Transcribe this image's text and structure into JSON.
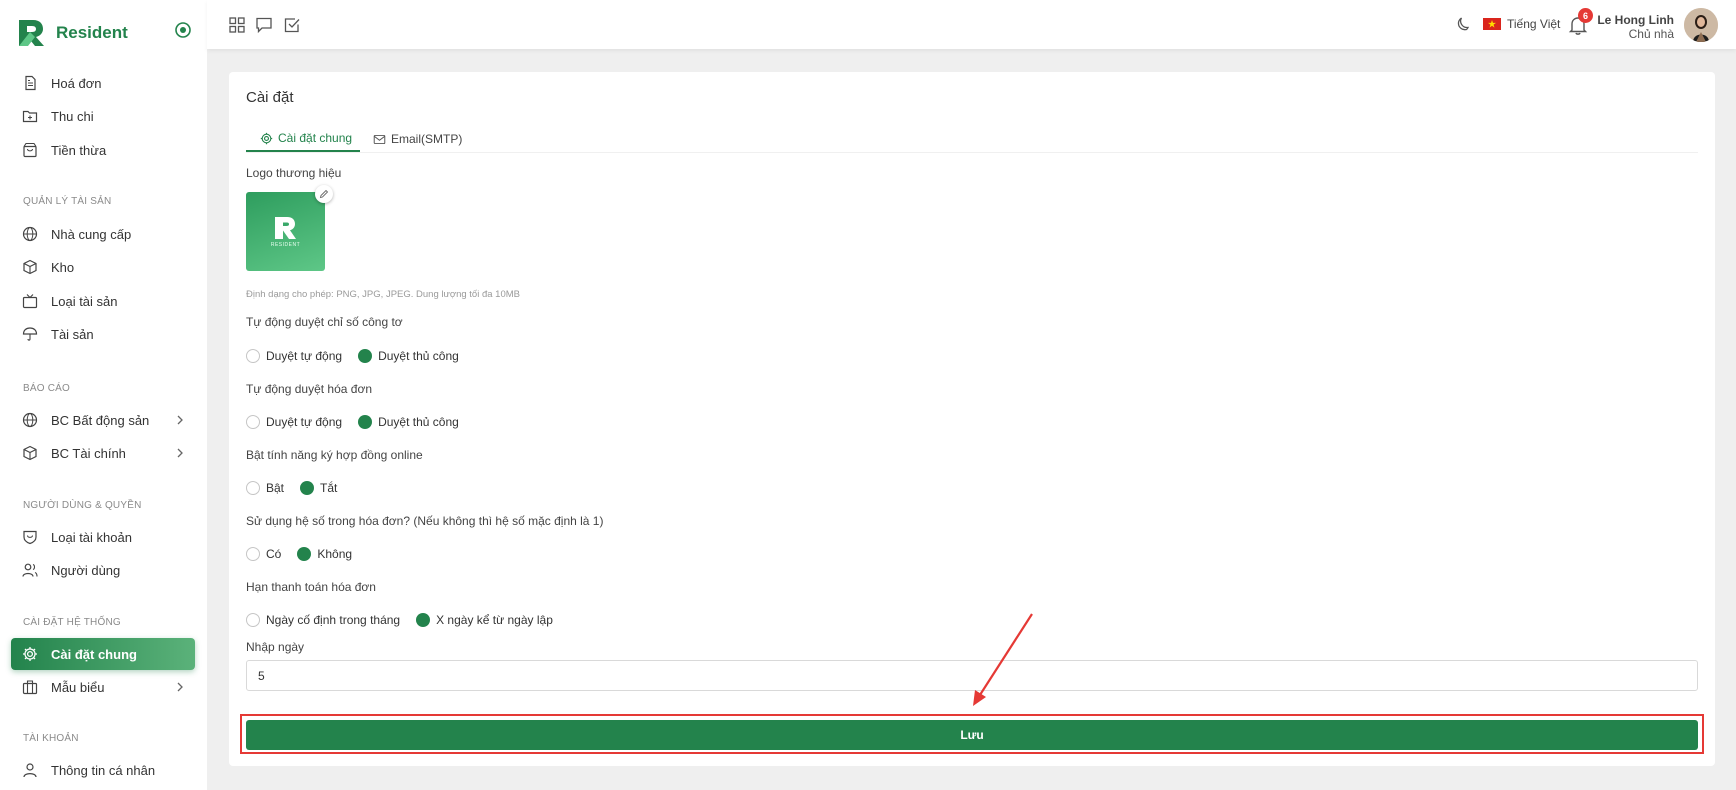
{
  "brand": {
    "name": "Resident"
  },
  "sidebar": {
    "items_top": [
      {
        "label": "Hoá đơn",
        "icon": "file-icon"
      },
      {
        "label": "Thu chi",
        "icon": "folder-plus-icon"
      },
      {
        "label": "Tiền thừa",
        "icon": "bag-icon"
      }
    ],
    "section_assets": "QUẢN LÝ TÀI SẢN",
    "items_assets": [
      {
        "label": "Nhà cung cấp",
        "icon": "globe-icon"
      },
      {
        "label": "Kho",
        "icon": "box-icon"
      },
      {
        "label": "Loại tài sản",
        "icon": "tv-icon"
      },
      {
        "label": "Tài sản",
        "icon": "umbrella-icon"
      }
    ],
    "section_reports": "BÁO CÁO",
    "items_reports": [
      {
        "label": "BC Bất động sản",
        "icon": "globe-icon"
      },
      {
        "label": "BC Tài chính",
        "icon": "box-icon"
      }
    ],
    "section_users": "NGƯỜI DÙNG & QUYỀN",
    "items_users": [
      {
        "label": "Loại tài khoản",
        "icon": "shield-icon"
      },
      {
        "label": "Người dùng",
        "icon": "users-icon"
      }
    ],
    "section_system": "CÀI ĐẶT HỆ THỐNG",
    "items_system": [
      {
        "label": "Cài đặt chung",
        "icon": "gear-icon",
        "active": true
      },
      {
        "label": "Mẫu biểu",
        "icon": "briefcase-icon"
      }
    ],
    "section_account": "TÀI KHOẢN",
    "items_account": [
      {
        "label": "Thông tin cá nhân",
        "icon": "user-icon"
      }
    ]
  },
  "topbar": {
    "language": "Tiếng Việt",
    "notification_count": "6",
    "user_name": "Le Hong Linh",
    "user_role": "Chủ nhà"
  },
  "page": {
    "title": "Cài đặt",
    "tabs": [
      {
        "label": "Cài đặt chung",
        "active": true
      },
      {
        "label": "Email(SMTP)"
      }
    ],
    "logo_label": "Logo thương hiệu",
    "logo_text": "RESIDENT",
    "logo_hint": "Định dạng cho phép: PNG, JPG, JPEG. Dung lượng tối đa 10MB",
    "meter": {
      "label": "Tự động duyệt chỉ số công tơ",
      "options": [
        "Duyệt tự động",
        "Duyệt thủ công"
      ],
      "selected": 1
    },
    "invoice": {
      "label": "Tự động duyệt hóa đơn",
      "options": [
        "Duyệt tự động",
        "Duyệt thủ công"
      ],
      "selected": 1
    },
    "contract": {
      "label": "Bật tính năng ký hợp đồng online",
      "options": [
        "Bật",
        "Tắt"
      ],
      "selected": 1
    },
    "coefficient": {
      "label": "Sử dụng hệ số trong hóa đơn? (Nếu không thì hệ số mặc định là 1)",
      "options": [
        "Có",
        "Không"
      ],
      "selected": 1
    },
    "due": {
      "label": "Hạn thanh toán hóa đơn",
      "options": [
        "Ngày cố định trong tháng",
        "X ngày kể từ ngày lập"
      ],
      "selected": 1
    },
    "days": {
      "label": "Nhập ngày",
      "value": "5"
    },
    "save_label": "Lưu"
  },
  "colors": {
    "accent": "#23834c",
    "highlight": "#e53935"
  }
}
